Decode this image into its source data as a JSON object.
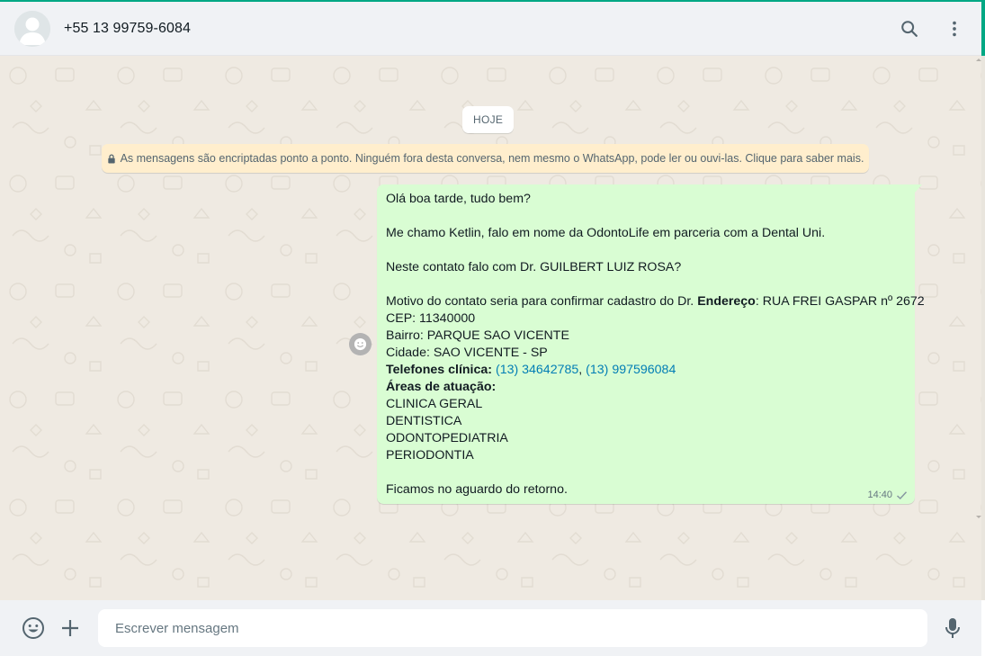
{
  "header": {
    "contact_name": "+55 13 99759-6084",
    "actions": [
      {
        "name": "search-icon"
      },
      {
        "name": "more-options-icon"
      }
    ]
  },
  "chat": {
    "date_chip": "HOJE",
    "encryption_notice": "As mensagens são encriptadas ponto a ponto. Ninguém fora desta conversa, nem mesmo o WhatsApp, pode ler ou ouvi-las. Clique para saber mais.",
    "message": {
      "direction": "outgoing",
      "lines": {
        "greeting": "Olá boa tarde, tudo bem?",
        "intro": "Me chamo Ketlin, falo em nome da OdontoLife em parceria com a Dental Uni.",
        "question": "Neste contato falo com Dr. GUILBERT LUIZ ROSA?",
        "motive_prefix": "Motivo do contato seria para confirmar cadastro do Dr. ",
        "address_label": "Endereço",
        "address_value": ": RUA FREI GASPAR nº 2672",
        "cep": "CEP: 11340000",
        "bairro": "Bairro: PARQUE SAO VICENTE",
        "cidade": "Cidade: SAO VICENTE - SP",
        "phones_label": "Telefones clínica:",
        "phone_1": "(13) 34642785",
        "phone_sep": ", ",
        "phone_2": "(13) 997596084",
        "areas_label": "Áreas de atuação:",
        "area_1": "CLINICA GERAL",
        "area_2": "DENTISTICA",
        "area_3": "ODONTOPEDIATRIA",
        "area_4": "PERIODONTIA",
        "closing": "Ficamos no aguardo do retorno."
      },
      "time": "14:40",
      "status": "sent"
    }
  },
  "composer": {
    "placeholder": "Escrever mensagem"
  },
  "colors": {
    "accent": "#00a884",
    "outgoing_bubble": "#d9fdd3",
    "chat_background": "#efeae2",
    "encryption_bg": "#ffeecd",
    "link": "#027eb5"
  }
}
